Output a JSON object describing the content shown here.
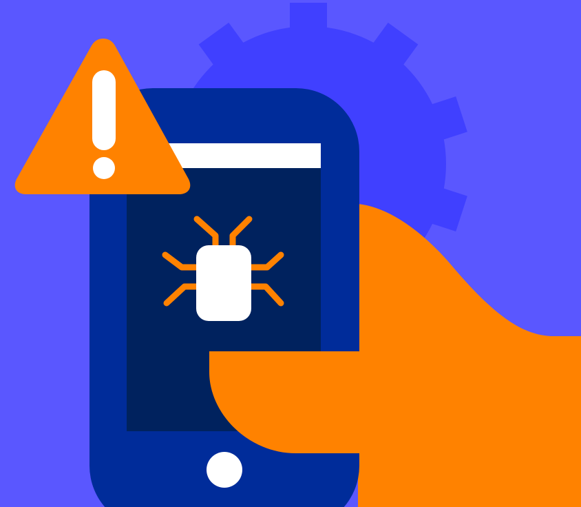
{
  "illustration": {
    "subject": [
      "gear-icon",
      "phone",
      "bug-icon",
      "hand",
      "warning-icon"
    ],
    "colors": {
      "background": "#5A57FF",
      "gear": "#4040FF",
      "phone_body": "#002C9A",
      "phone_screen": "#00225E",
      "screen_bar": "#FFFFFF",
      "home_button": "#FFFFFF",
      "bug_body": "#FFFFFF",
      "bug_legs": "#FF8200",
      "hand": "#FF8200",
      "warning_triangle": "#FF8200",
      "warning_mark": "#FFFFFF"
    }
  }
}
